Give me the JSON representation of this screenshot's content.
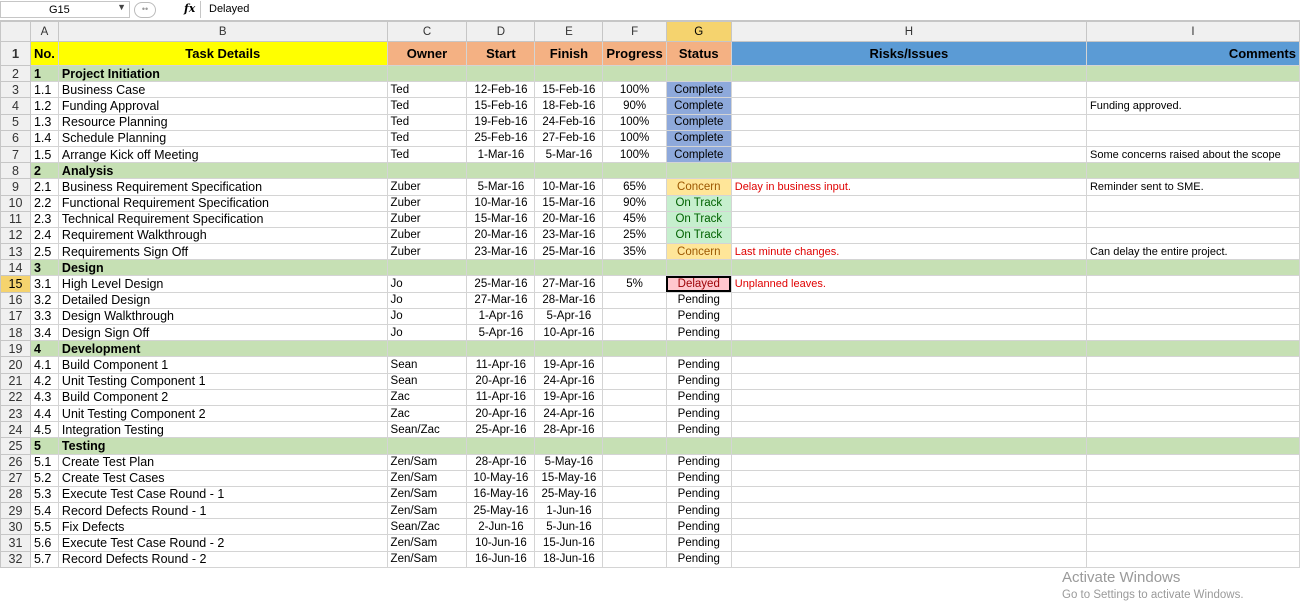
{
  "formula_bar": {
    "name_box": "G15",
    "fx": "fx",
    "content": "Delayed"
  },
  "columns": [
    "A",
    "B",
    "C",
    "D",
    "E",
    "F",
    "G",
    "H",
    "I"
  ],
  "header": {
    "no": "No.",
    "task": "Task Details",
    "owner": "Owner",
    "start": "Start",
    "finish": "Finish",
    "progress": "Progress",
    "status": "Status",
    "risks": "Risks/Issues",
    "comments": "Comments"
  },
  "rows": [
    {
      "r": "2",
      "type": "phase",
      "no": "1",
      "task": "Project Initiation"
    },
    {
      "r": "3",
      "no": "1.1",
      "task": "Business Case",
      "owner": "Ted",
      "start": "12-Feb-16",
      "finish": "15-Feb-16",
      "progress": "100%",
      "status": "Complete",
      "cls": "complete",
      "risk": "",
      "comment": ""
    },
    {
      "r": "4",
      "no": "1.2",
      "task": "Funding Approval",
      "owner": "Ted",
      "start": "15-Feb-16",
      "finish": "18-Feb-16",
      "progress": "90%",
      "status": "Complete",
      "cls": "complete",
      "risk": "",
      "comment": "Funding approved."
    },
    {
      "r": "5",
      "no": "1.3",
      "task": "Resource Planning",
      "owner": "Ted",
      "start": "19-Feb-16",
      "finish": "24-Feb-16",
      "progress": "100%",
      "status": "Complete",
      "cls": "complete",
      "risk": "",
      "comment": ""
    },
    {
      "r": "6",
      "no": "1.4",
      "task": "Schedule Planning",
      "owner": "Ted",
      "start": "25-Feb-16",
      "finish": "27-Feb-16",
      "progress": "100%",
      "status": "Complete",
      "cls": "complete",
      "risk": "",
      "comment": ""
    },
    {
      "r": "7",
      "no": "1.5",
      "task": "Arrange Kick off Meeting",
      "owner": "Ted",
      "start": "1-Mar-16",
      "finish": "5-Mar-16",
      "progress": "100%",
      "status": "Complete",
      "cls": "complete",
      "risk": "",
      "comment": "Some concerns raised about the scope"
    },
    {
      "r": "8",
      "type": "phase",
      "no": "2",
      "task": "Analysis"
    },
    {
      "r": "9",
      "no": "2.1",
      "task": "Business Requirement Specification",
      "owner": "Zuber",
      "start": "5-Mar-16",
      "finish": "10-Mar-16",
      "progress": "65%",
      "status": "Concern",
      "cls": "concern",
      "risk": "Delay in business input.",
      "comment": "Reminder sent to SME."
    },
    {
      "r": "10",
      "no": "2.2",
      "task": "Functional Requirement Specification",
      "owner": "Zuber",
      "start": "10-Mar-16",
      "finish": "15-Mar-16",
      "progress": "90%",
      "status": "On Track",
      "cls": "ontrack",
      "risk": "",
      "comment": ""
    },
    {
      "r": "11",
      "no": "2.3",
      "task": "Technical Requirement Specification",
      "owner": "Zuber",
      "start": "15-Mar-16",
      "finish": "20-Mar-16",
      "progress": "45%",
      "status": "On Track",
      "cls": "ontrack",
      "risk": "",
      "comment": ""
    },
    {
      "r": "12",
      "no": "2.4",
      "task": "Requirement Walkthrough",
      "owner": "Zuber",
      "start": "20-Mar-16",
      "finish": "23-Mar-16",
      "progress": "25%",
      "status": "On Track",
      "cls": "ontrack",
      "risk": "",
      "comment": ""
    },
    {
      "r": "13",
      "no": "2.5",
      "task": "Requirements Sign Off",
      "owner": "Zuber",
      "start": "23-Mar-16",
      "finish": "25-Mar-16",
      "progress": "35%",
      "status": "Concern",
      "cls": "concern",
      "risk": "Last minute changes.",
      "comment": "Can delay the entire project."
    },
    {
      "r": "14",
      "type": "phase",
      "no": "3",
      "task": "Design"
    },
    {
      "r": "15",
      "no": "3.1",
      "task": "High Level Design",
      "owner": "Jo",
      "start": "25-Mar-16",
      "finish": "27-Mar-16",
      "progress": "5%",
      "status": "Delayed",
      "cls": "delayed",
      "risk": "Unplanned leaves.",
      "comment": "",
      "sel": true
    },
    {
      "r": "16",
      "no": "3.2",
      "task": "Detailed Design",
      "owner": "Jo",
      "start": "27-Mar-16",
      "finish": "28-Mar-16",
      "progress": "",
      "status": "Pending",
      "cls": "",
      "risk": "",
      "comment": ""
    },
    {
      "r": "17",
      "no": "3.3",
      "task": "Design Walkthrough",
      "owner": "Jo",
      "start": "1-Apr-16",
      "finish": "5-Apr-16",
      "progress": "",
      "status": "Pending",
      "cls": "",
      "risk": "",
      "comment": ""
    },
    {
      "r": "18",
      "no": "3.4",
      "task": "Design Sign Off",
      "owner": "Jo",
      "start": "5-Apr-16",
      "finish": "10-Apr-16",
      "progress": "",
      "status": "Pending",
      "cls": "",
      "risk": "",
      "comment": ""
    },
    {
      "r": "19",
      "type": "phase",
      "no": "4",
      "task": "Development"
    },
    {
      "r": "20",
      "no": "4.1",
      "task": "Build Component 1",
      "owner": "Sean",
      "start": "11-Apr-16",
      "finish": "19-Apr-16",
      "progress": "",
      "status": "Pending",
      "cls": "",
      "risk": "",
      "comment": ""
    },
    {
      "r": "21",
      "no": "4.2",
      "task": "Unit Testing Component 1",
      "owner": "Sean",
      "start": "20-Apr-16",
      "finish": "24-Apr-16",
      "progress": "",
      "status": "Pending",
      "cls": "",
      "risk": "",
      "comment": ""
    },
    {
      "r": "22",
      "no": "4.3",
      "task": "Build Component 2",
      "owner": "Zac",
      "start": "11-Apr-16",
      "finish": "19-Apr-16",
      "progress": "",
      "status": "Pending",
      "cls": "",
      "risk": "",
      "comment": ""
    },
    {
      "r": "23",
      "no": "4.4",
      "task": "Unit Testing Component 2",
      "owner": "Zac",
      "start": "20-Apr-16",
      "finish": "24-Apr-16",
      "progress": "",
      "status": "Pending",
      "cls": "",
      "risk": "",
      "comment": ""
    },
    {
      "r": "24",
      "no": "4.5",
      "task": "Integration Testing",
      "owner": "Sean/Zac",
      "start": "25-Apr-16",
      "finish": "28-Apr-16",
      "progress": "",
      "status": "Pending",
      "cls": "",
      "risk": "",
      "comment": ""
    },
    {
      "r": "25",
      "type": "phase",
      "no": "5",
      "task": "Testing"
    },
    {
      "r": "26",
      "no": "5.1",
      "task": "Create Test Plan",
      "owner": "Zen/Sam",
      "start": "28-Apr-16",
      "finish": "5-May-16",
      "progress": "",
      "status": "Pending",
      "cls": "",
      "risk": "",
      "comment": ""
    },
    {
      "r": "27",
      "no": "5.2",
      "task": "Create Test Cases",
      "owner": "Zen/Sam",
      "start": "10-May-16",
      "finish": "15-May-16",
      "progress": "",
      "status": "Pending",
      "cls": "",
      "risk": "",
      "comment": ""
    },
    {
      "r": "28",
      "no": "5.3",
      "task": "Execute Test Case Round - 1",
      "owner": "Zen/Sam",
      "start": "16-May-16",
      "finish": "25-May-16",
      "progress": "",
      "status": "Pending",
      "cls": "",
      "risk": "",
      "comment": ""
    },
    {
      "r": "29",
      "no": "5.4",
      "task": "Record Defects Round - 1",
      "owner": "Zen/Sam",
      "start": "25-May-16",
      "finish": "1-Jun-16",
      "progress": "",
      "status": "Pending",
      "cls": "",
      "risk": "",
      "comment": ""
    },
    {
      "r": "30",
      "no": "5.5",
      "task": "Fix Defects",
      "owner": "Sean/Zac",
      "start": "2-Jun-16",
      "finish": "5-Jun-16",
      "progress": "",
      "status": "Pending",
      "cls": "",
      "risk": "",
      "comment": ""
    },
    {
      "r": "31",
      "no": "5.6",
      "task": "Execute Test Case Round - 2",
      "owner": "Zen/Sam",
      "start": "10-Jun-16",
      "finish": "15-Jun-16",
      "progress": "",
      "status": "Pending",
      "cls": "",
      "risk": "",
      "comment": ""
    },
    {
      "r": "32",
      "no": "5.7",
      "task": "Record Defects Round - 2",
      "owner": "Zen/Sam",
      "start": "16-Jun-16",
      "finish": "18-Jun-16",
      "progress": "",
      "status": "Pending",
      "cls": "",
      "risk": "",
      "comment": ""
    }
  ],
  "watermark": {
    "line1": "Activate Windows",
    "line2": "Go to Settings to activate Windows."
  }
}
